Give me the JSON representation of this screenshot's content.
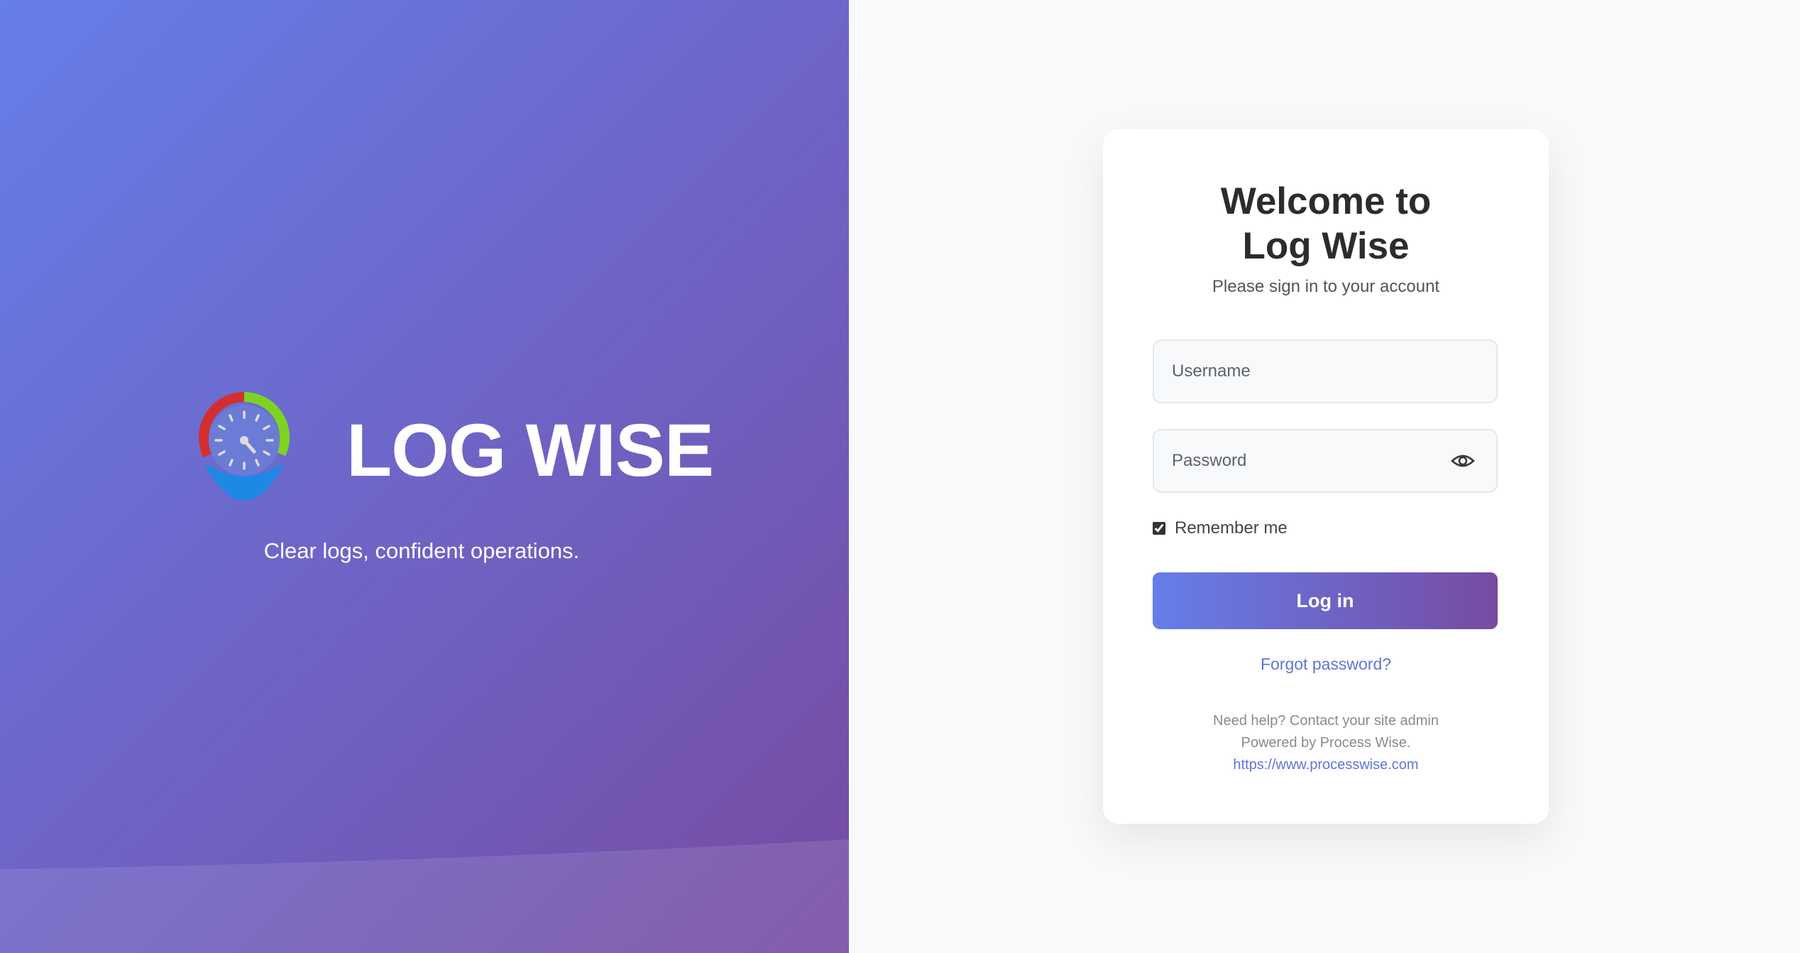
{
  "brand": {
    "name": "LOG WISE",
    "tagline": "Clear logs, confident operations."
  },
  "login": {
    "title_line1": "Welcome to",
    "title_line2": "Log Wise",
    "subtitle": "Please sign in to your account",
    "username_placeholder": "Username",
    "password_placeholder": "Password",
    "remember_label": "Remember me",
    "remember_checked": true,
    "submit_label": "Log in",
    "forgot_label": "Forgot password?",
    "help_text": "Need help? Contact your site admin",
    "powered_by": "Powered by Process Wise.",
    "website": "https://www.processwise.com"
  },
  "icons": {
    "logo": "log-wise-clock-pin-logo",
    "password_toggle": "eye-icon"
  },
  "colors": {
    "gradient_start": "#667eea",
    "gradient_end": "#764ba2",
    "link": "#5f76d8",
    "logo_red": "#d32f2f",
    "logo_green": "#7ed321",
    "logo_blue": "#1e88e5"
  }
}
